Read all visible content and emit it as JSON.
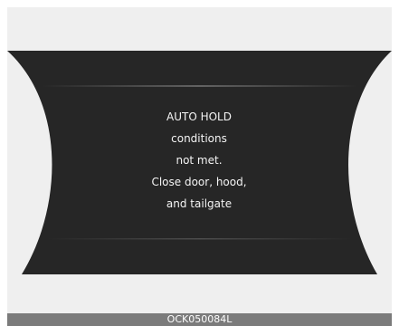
{
  "display": {
    "message_lines": [
      "AUTO HOLD",
      "conditions",
      "not met.",
      "Close door, hood,",
      "and tailgate"
    ]
  },
  "caption": {
    "code": "OCK050084L"
  },
  "colors": {
    "panel_background": "#efefef",
    "cluster_fill": "#262626",
    "text": "#f4f4f4",
    "caption_bar": "#7b7b7b"
  }
}
